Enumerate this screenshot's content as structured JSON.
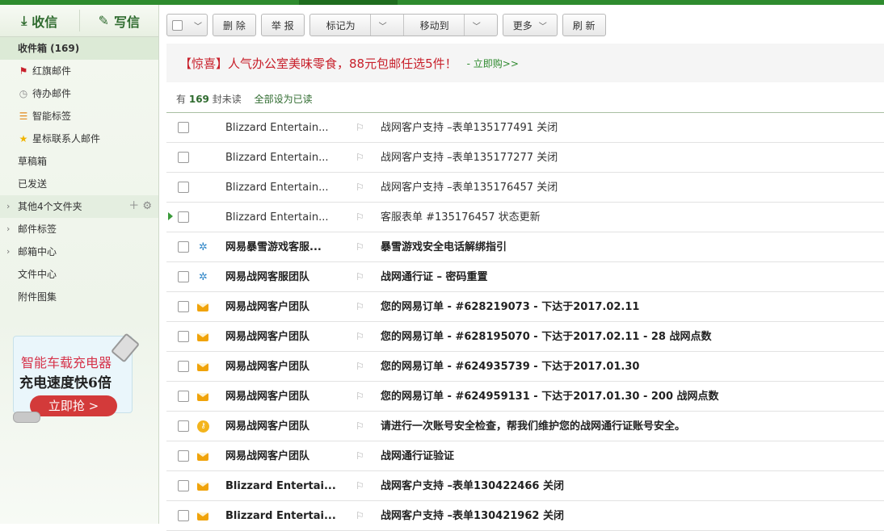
{
  "compose": {
    "receive_label": "收信",
    "write_label": "写信"
  },
  "sidebar": {
    "items": [
      {
        "label": "收件箱 (169)",
        "icon": "",
        "active": true
      },
      {
        "label": "红旗邮件",
        "icon": "red-flag-icon"
      },
      {
        "label": "待办邮件",
        "icon": "clock-icon"
      },
      {
        "label": "智能标签",
        "icon": "stacked-tags-icon"
      },
      {
        "label": "星标联系人邮件",
        "icon": "star-icon"
      },
      {
        "label": "草稿箱"
      },
      {
        "label": "已发送"
      },
      {
        "label": "其他4个文件夹",
        "expandable": true
      },
      {
        "label": "邮件标签",
        "expandable": true
      },
      {
        "label": "邮箱中心",
        "expandable": true
      },
      {
        "label": "文件中心"
      },
      {
        "label": "附件图集"
      }
    ]
  },
  "ad": {
    "line1": "智能车载充电器",
    "line2": "充电速度快6倍",
    "cta": "立即抢 >"
  },
  "toolbar": {
    "delete": "删 除",
    "report": "举 报",
    "mark_as": "标记为",
    "move_to": "移动到",
    "more": "更多",
    "refresh": "刷 新"
  },
  "promo": {
    "text": "【惊喜】人气办公室美味零食，88元包邮任选5件！",
    "link": "- 立即购>>"
  },
  "summary": {
    "prefix": "有",
    "count": "169",
    "suffix": "封未读",
    "mark_all": "全部设为已读"
  },
  "messages": [
    {
      "from": "Blizzard Entertain...",
      "subject": "战网客户支持 –表单135177491 关闭",
      "unread": false,
      "icon": "none"
    },
    {
      "from": "Blizzard Entertain...",
      "subject": "战网客户支持 –表单135177277 关闭",
      "unread": false,
      "icon": "none"
    },
    {
      "from": "Blizzard Entertain...",
      "subject": "战网客户支持 –表单135176457 关闭",
      "unread": false,
      "icon": "none"
    },
    {
      "from": "Blizzard Entertain...",
      "subject": "客服表单 #135176457 状态更新",
      "unread": false,
      "icon": "none",
      "current": true
    },
    {
      "from": "网易暴雪游戏客服...",
      "subject": "暴雪游戏安全电话解绑指引",
      "unread": true,
      "icon": "blizzard-icon"
    },
    {
      "from": "网易战网客服团队",
      "subject": "战网通行证 – 密码重置",
      "unread": true,
      "icon": "blizzard-icon"
    },
    {
      "from": "网易战网客户团队",
      "subject": "您的网易订单 - #628219073 - 下达于2017.02.11",
      "unread": true,
      "icon": "envelope-icon"
    },
    {
      "from": "网易战网客户团队",
      "subject": "您的网易订单 - #628195070 - 下达于2017.02.11 - 28 战网点数",
      "unread": true,
      "icon": "envelope-icon"
    },
    {
      "from": "网易战网客户团队",
      "subject": "您的网易订单 - #624935739 - 下达于2017.01.30",
      "unread": true,
      "icon": "envelope-icon"
    },
    {
      "from": "网易战网客户团队",
      "subject": "您的网易订单 - #624959131 - 下达于2017.01.30 - 200 战网点数",
      "unread": true,
      "icon": "envelope-icon"
    },
    {
      "from": "网易战网客户团队",
      "subject": "请进行一次账号安全检查，帮我们维护您的战网通行证账号安全。",
      "unread": true,
      "icon": "key-icon"
    },
    {
      "from": "网易战网客户团队",
      "subject": "战网通行证验证",
      "unread": true,
      "icon": "envelope-icon"
    },
    {
      "from": "Blizzard Entertai...",
      "subject": "战网客户支持 –表单130422466 关闭",
      "unread": true,
      "icon": "envelope-icon"
    },
    {
      "from": "Blizzard Entertai...",
      "subject": "战网客户支持 –表单130421962 关闭",
      "unread": true,
      "icon": "envelope-icon"
    }
  ]
}
